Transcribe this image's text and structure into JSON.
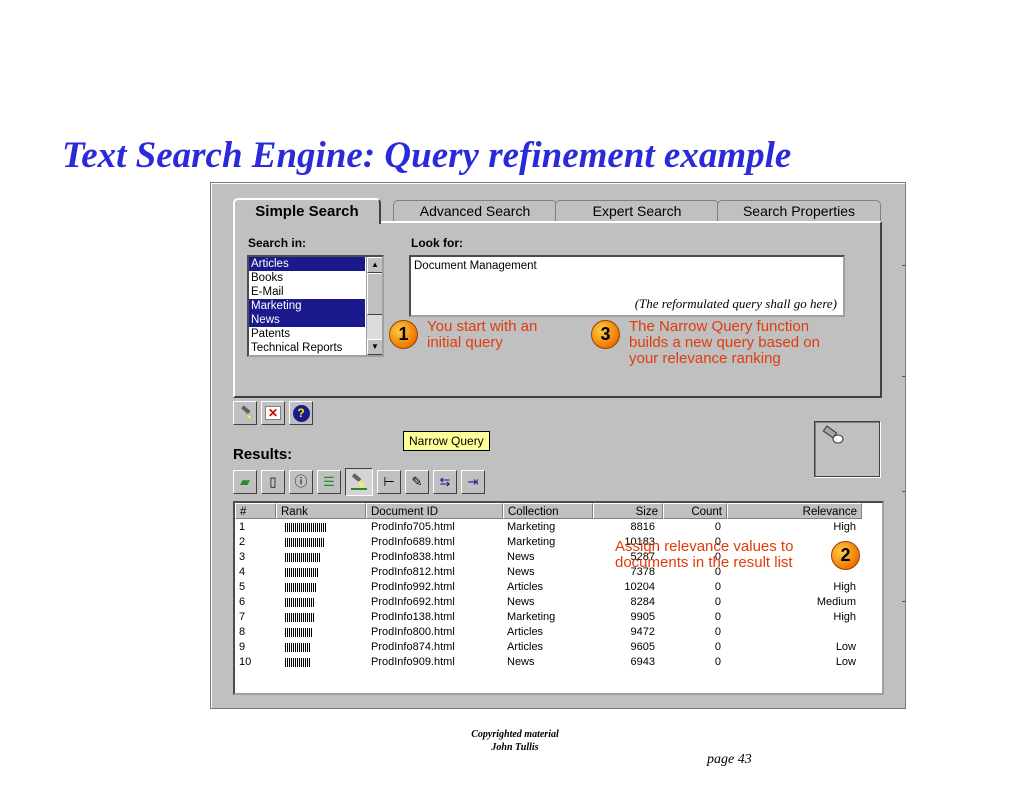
{
  "slide": {
    "title": "Text Search Engine: Query refinement example",
    "copyright_line1": "Copyrighted material",
    "copyright_line2": "John Tullis",
    "page": "page 43"
  },
  "tabs": [
    "Simple Search",
    "Advanced Search",
    "Expert Search",
    "Search Properties"
  ],
  "active_tab": "Simple Search",
  "search_in": {
    "label": "Search in:",
    "items": [
      {
        "label": "Articles",
        "selected": true
      },
      {
        "label": "Books",
        "selected": false
      },
      {
        "label": "E-Mail",
        "selected": false
      },
      {
        "label": "Marketing",
        "selected": true
      },
      {
        "label": "News",
        "selected": true
      },
      {
        "label": "Patents",
        "selected": false
      },
      {
        "label": "Technical Reports",
        "selected": false
      }
    ]
  },
  "look_for": {
    "label": "Look for:",
    "value": "Document Management",
    "note": "(The reformulated query shall go here)"
  },
  "annotations": {
    "step1_number": "1",
    "step1_line1": "You start with an",
    "step1_line2": "initial query",
    "step2_number": "2",
    "step2_line1": "Assign relevance values to",
    "step2_line2": "documents in the result list",
    "step3_number": "3",
    "step3_line1": "The Narrow Query function",
    "step3_line2": "builds a new query based on",
    "step3_line3": "your relevance ranking"
  },
  "search_toolbar": {
    "search_icon": "flashlight-icon",
    "clear_icon": "red-x-icon",
    "help_label": "?"
  },
  "results": {
    "label": "Results:",
    "tooltip": "Narrow Query",
    "toolbar_icons": [
      "open-folder-icon",
      "new-document-icon",
      "document-info-icon",
      "checklist-icon",
      "narrow-query-icon",
      "tree-icon",
      "edit-document-icon",
      "move-left-icon",
      "move-right-icon"
    ],
    "columns": [
      "#",
      "Rank",
      "Document ID",
      "Collection",
      "Size",
      "Count",
      "Relevance"
    ],
    "rows": [
      {
        "num": "1",
        "rank": 1.0,
        "doc": "ProdInfo705.html",
        "collection": "Marketing",
        "size": "8816",
        "count": "0",
        "relevance": "High"
      },
      {
        "num": "2",
        "rank": 0.92,
        "doc": "ProdInfo689.html",
        "collection": "Marketing",
        "size": "10183",
        "count": "0",
        "relevance": ""
      },
      {
        "num": "3",
        "rank": 0.85,
        "doc": "ProdInfo838.html",
        "collection": "News",
        "size": "5287",
        "count": "0",
        "relevance": ""
      },
      {
        "num": "4",
        "rank": 0.8,
        "doc": "ProdInfo812.html",
        "collection": "News",
        "size": "7378",
        "count": "0",
        "relevance": ""
      },
      {
        "num": "5",
        "rank": 0.75,
        "doc": "ProdInfo992.html",
        "collection": "Articles",
        "size": "10204",
        "count": "0",
        "relevance": "High"
      },
      {
        "num": "6",
        "rank": 0.72,
        "doc": "ProdInfo692.html",
        "collection": "News",
        "size": "8284",
        "count": "0",
        "relevance": "Medium"
      },
      {
        "num": "7",
        "rank": 0.7,
        "doc": "ProdInfo138.html",
        "collection": "Marketing",
        "size": "9905",
        "count": "0",
        "relevance": "High"
      },
      {
        "num": "8",
        "rank": 0.65,
        "doc": "ProdInfo800.html",
        "collection": "Articles",
        "size": "9472",
        "count": "0",
        "relevance": ""
      },
      {
        "num": "9",
        "rank": 0.62,
        "doc": "ProdInfo874.html",
        "collection": "Articles",
        "size": "9605",
        "count": "0",
        "relevance": "Low"
      },
      {
        "num": "10",
        "rank": 0.6,
        "doc": "ProdInfo909.html",
        "collection": "News",
        "size": "6943",
        "count": "0",
        "relevance": "Low"
      }
    ]
  },
  "colors": {
    "title": "#2a2ad8",
    "annotation": "#e03c0c",
    "selection": "#1a1a8c",
    "window": "#c0c0c0",
    "tooltip": "#ffff99"
  }
}
